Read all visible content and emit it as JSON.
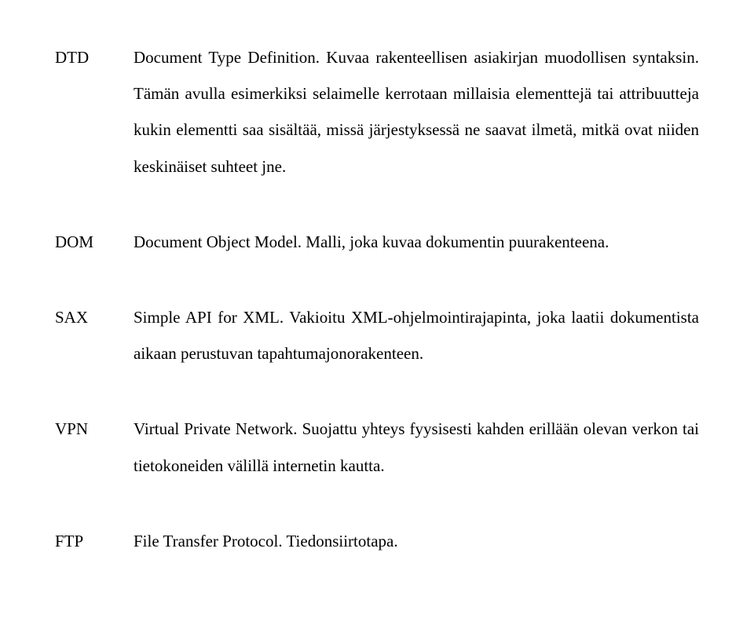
{
  "glossary": [
    {
      "term": "DTD",
      "definition": "Document Type Definition. Kuvaa rakenteellisen asiakirjan muodollisen syntaksin. Tämän avulla esimerkiksi selaimelle kerrotaan millaisia elementtejä tai attribuutteja kukin elementti saa sisältää, missä järjestyksessä ne saavat ilmetä, mitkä ovat niiden keskinäiset suhteet jne."
    },
    {
      "term": "DOM",
      "definition": "Document Object Model. Malli, joka kuvaa dokumentin puurakenteena."
    },
    {
      "term": "SAX",
      "definition": "Simple API for XML. Vakioitu XML-ohjelmointirajapinta, joka laatii dokumentista aikaan perustuvan tapahtumajonorakenteen."
    },
    {
      "term": "VPN",
      "definition": "Virtual Private Network. Suojattu yhteys fyysisesti kahden erillään olevan verkon tai tietokoneiden välillä internetin kautta."
    },
    {
      "term": "FTP",
      "definition": "File Transfer Protocol. Tiedonsiirtotapa."
    }
  ]
}
